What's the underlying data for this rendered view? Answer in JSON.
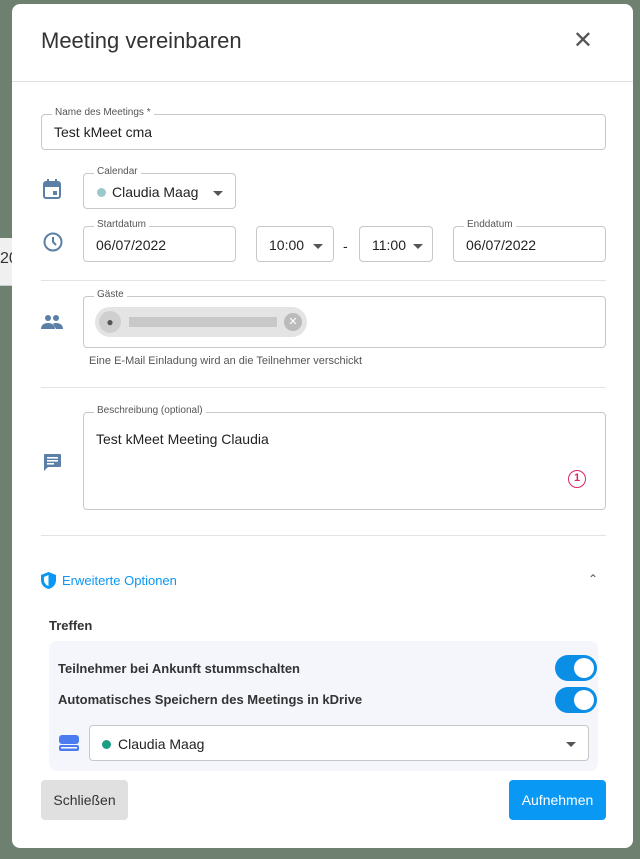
{
  "background": {
    "fragment": "20"
  },
  "dialog": {
    "title": "Meeting vereinbaren",
    "name_label": "Name des Meetings *",
    "name_value": "Test kMeet cma",
    "calendar_label": "Calendar",
    "calendar_value": "Claudia Maag",
    "start_label": "Startdatum",
    "start_value": "06/07/2022",
    "start_time": "10:00",
    "separator": "-",
    "end_time": "11:00",
    "end_label": "Enddatum",
    "end_value": "06/07/2022",
    "guests_label": "Gäste",
    "guests_hint": "Eine E-Mail Einladung wird an die Teilnehmer verschickt",
    "desc_label": "Beschreibung (optional)",
    "desc_value": "Test kMeet Meeting Claudia",
    "desc_badge": "1",
    "advanced_label": "Erweiterte Optionen",
    "section_title": "Treffen",
    "toggles": [
      {
        "label": "Teilnehmer bei Ankunft stummschalten",
        "on": true
      },
      {
        "label": "Automatisches Speichern des Meetings in kDrive",
        "on": true
      }
    ],
    "drive_value": "Claudia Maag",
    "close_label": "Schließen",
    "submit_label": "Aufnehmen"
  },
  "colors": {
    "accent": "#0a98f5",
    "calendar_dot": "#9cc9c9",
    "drive_dot": "#1a9e86",
    "badge": "#e0245e"
  }
}
